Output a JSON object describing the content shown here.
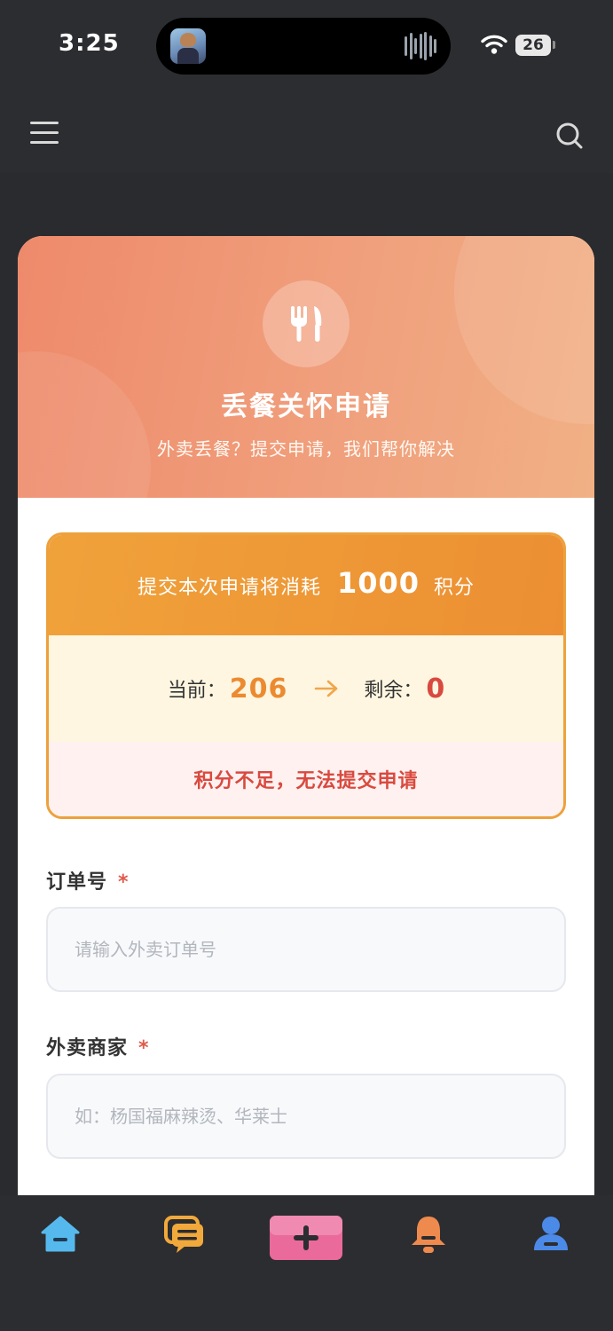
{
  "status_bar": {
    "time": "3:25",
    "battery": "26",
    "icons": [
      "app-avatar-icon",
      "audio-wave-icon",
      "wifi-icon",
      "battery-icon"
    ]
  },
  "header": {
    "icons": [
      "menu-icon",
      "search-icon"
    ]
  },
  "hero": {
    "icon": "fork-knife-icon",
    "title": "丢餐关怀申请",
    "subtitle": "外卖丢餐？提交申请，我们帮你解决"
  },
  "points": {
    "cost_prefix": "提交本次申请将消耗",
    "cost_amount": "1000",
    "cost_suffix": "积分",
    "current_label": "当前：",
    "current_value": "206",
    "remain_label": "剩余：",
    "remain_value": "0",
    "warning": "积分不足，无法提交申请",
    "colors": {
      "accent": "#ec8f33",
      "danger": "#d94a3f",
      "balance_bg": "#fef6e1"
    }
  },
  "form": {
    "order_no": {
      "label": "订单号",
      "required_mark": "*",
      "placeholder": "请输入外卖订单号",
      "value": ""
    },
    "merchant": {
      "label": "外卖商家",
      "required_mark": "*",
      "placeholder": "如：杨国福麻辣烫、华莱士",
      "value": ""
    }
  },
  "tab_bar": {
    "tabs": [
      {
        "icon": "home-icon",
        "color": "#56b9ee"
      },
      {
        "icon": "chat-icon",
        "color": "#f2a93b"
      },
      {
        "icon": "plus-icon",
        "color": "#ea6a9b"
      },
      {
        "icon": "bell-icon",
        "color": "#ef8a4e"
      },
      {
        "icon": "user-icon",
        "color": "#4c8ae8"
      }
    ]
  }
}
